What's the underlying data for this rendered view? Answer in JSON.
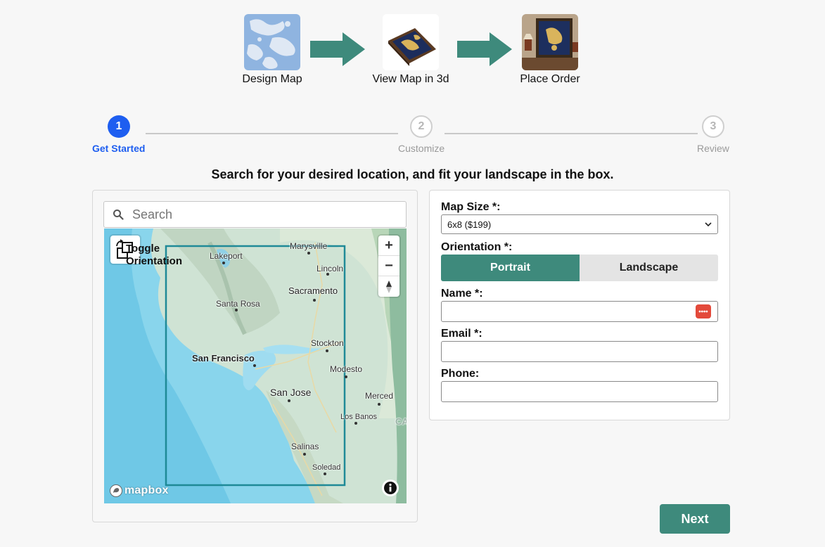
{
  "process": {
    "steps": [
      {
        "label": "Design Map",
        "icon": "design-map-thumbnail"
      },
      {
        "label": "View Map in 3d",
        "icon": "3d-frame-thumbnail"
      },
      {
        "label": "Place Order",
        "icon": "framed-map-room-thumbnail"
      }
    ],
    "arrow_color": "#3e8a7c"
  },
  "stepper": {
    "steps": [
      {
        "number": "1",
        "label": "Get Started",
        "state": "active"
      },
      {
        "number": "2",
        "label": "Customize",
        "state": "inactive"
      },
      {
        "number": "3",
        "label": "Review",
        "state": "inactive"
      }
    ],
    "active_color": "#1e5ef0"
  },
  "instruction": "Search for your desired location, and fit your landscape in the box.",
  "map": {
    "search_placeholder": "Search",
    "toggle_label": "Toggle Orientation",
    "zoom_in": "+",
    "zoom_out": "−",
    "attribution_logo": "mapbox",
    "cities": {
      "marysville": "Marysville",
      "lakeport": "Lakeport",
      "lincoln": "Lincoln",
      "sacramento": "Sacramento",
      "santa_rosa": "Santa Rosa",
      "stockton": "Stockton",
      "san_francisco": "San Francisco",
      "modesto": "Modesto",
      "san_jose": "San Jose",
      "merced": "Merced",
      "los_banos": "Los Banos",
      "ca": "CA",
      "salinas": "Salinas",
      "soledad": "Soledad"
    }
  },
  "form": {
    "map_size_label": "Map Size *:",
    "map_size_value": "6x8 ($199)",
    "orientation_label": "Orientation *:",
    "orientation_options": [
      "Portrait",
      "Landscape"
    ],
    "orientation_selected": "Portrait",
    "name_label": "Name *:",
    "email_label": "Email *:",
    "phone_label": "Phone:",
    "accent_color": "#3e8a7c"
  },
  "next_button": "Next"
}
